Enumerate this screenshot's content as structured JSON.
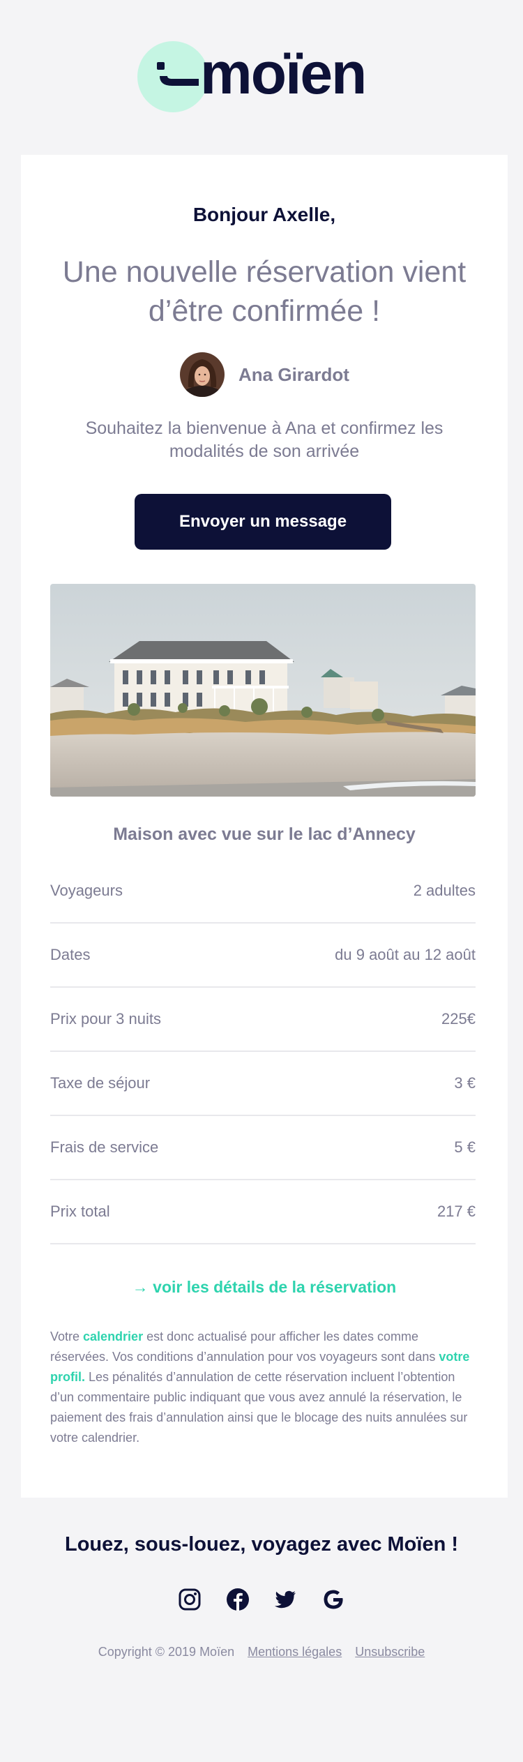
{
  "brand": {
    "name": "moïen",
    "accent_color": "#2ed3ae",
    "dark_color": "#0d1137",
    "logo_circle_color": "#c5f5e3"
  },
  "email": {
    "greeting": "Bonjour Axelle,",
    "headline": "Une nouvelle réservation vient d’être confirmée !",
    "host_name": "Ana Girardot",
    "subtitle": "Souhaitez la bienvenue à Ana et confirmez les modalités de son arrivée",
    "cta_label": "Envoyer un message",
    "property_title": "Maison avec vue sur le lac d’Annecy",
    "details": [
      {
        "label": "Voyageurs",
        "value": "2 adultes"
      },
      {
        "label": "Dates",
        "value": "du 9 août au 12 août"
      },
      {
        "label": "Prix pour 3 nuits",
        "value": "225€"
      },
      {
        "label": "Taxe de séjour",
        "value": "3 €"
      },
      {
        "label": "Frais de service",
        "value": "5 €"
      },
      {
        "label": "Prix total",
        "value": "217 €"
      }
    ],
    "details_link": "→ voir les détails de la réservation",
    "legal": {
      "part1": "Votre ",
      "link_calendar": "calendrier",
      "part2": " est donc actualisé pour afficher les dates comme réservées. Vos conditions d’annulation pour vos voyageurs sont dans ",
      "link_profile": "votre profil.",
      "part3": " Les pénalités d’annulation de cette réservation incluent l’obtention d’un commentaire public indiquant que vous avez annulé la réservation, le paiement des frais d’annulation ainsi que le blocage des nuits annulées sur votre calendrier."
    }
  },
  "footer": {
    "tagline": "Louez, sous-louez, voyagez avec Moïen !",
    "socials": [
      "instagram-icon",
      "facebook-icon",
      "twitter-icon",
      "google-icon"
    ],
    "copyright": "Copyright © 2019 Moïen",
    "mentions": "Mentions légales",
    "unsubscribe": "Unsubscribe"
  }
}
